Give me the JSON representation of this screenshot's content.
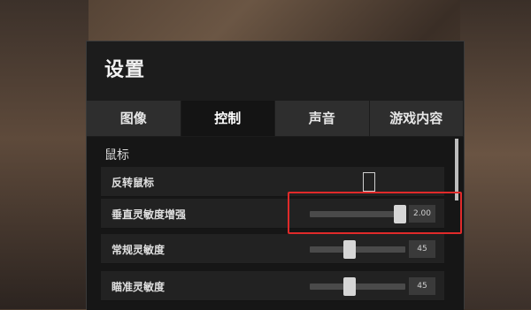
{
  "window": {
    "title": "设置"
  },
  "tabs": [
    {
      "label": "图像",
      "active": false
    },
    {
      "label": "控制",
      "active": true
    },
    {
      "label": "声音",
      "active": false
    },
    {
      "label": "游戏内容",
      "active": false
    }
  ],
  "section": {
    "label": "鼠标"
  },
  "settings": [
    {
      "label": "反转鼠标",
      "type": "checkbox",
      "checked": false
    },
    {
      "label": "垂直灵敏度增强",
      "type": "slider",
      "value_text": "2.00",
      "fraction": 0.94
    },
    {
      "label": "常规灵敏度",
      "type": "slider",
      "value_text": "45",
      "fraction": 0.42
    },
    {
      "label": "瞄准灵敏度",
      "type": "slider",
      "value_text": "45",
      "fraction": 0.42
    }
  ],
  "annotation": {
    "color": "#e02a2a",
    "target": "垂直灵敏度增强"
  }
}
